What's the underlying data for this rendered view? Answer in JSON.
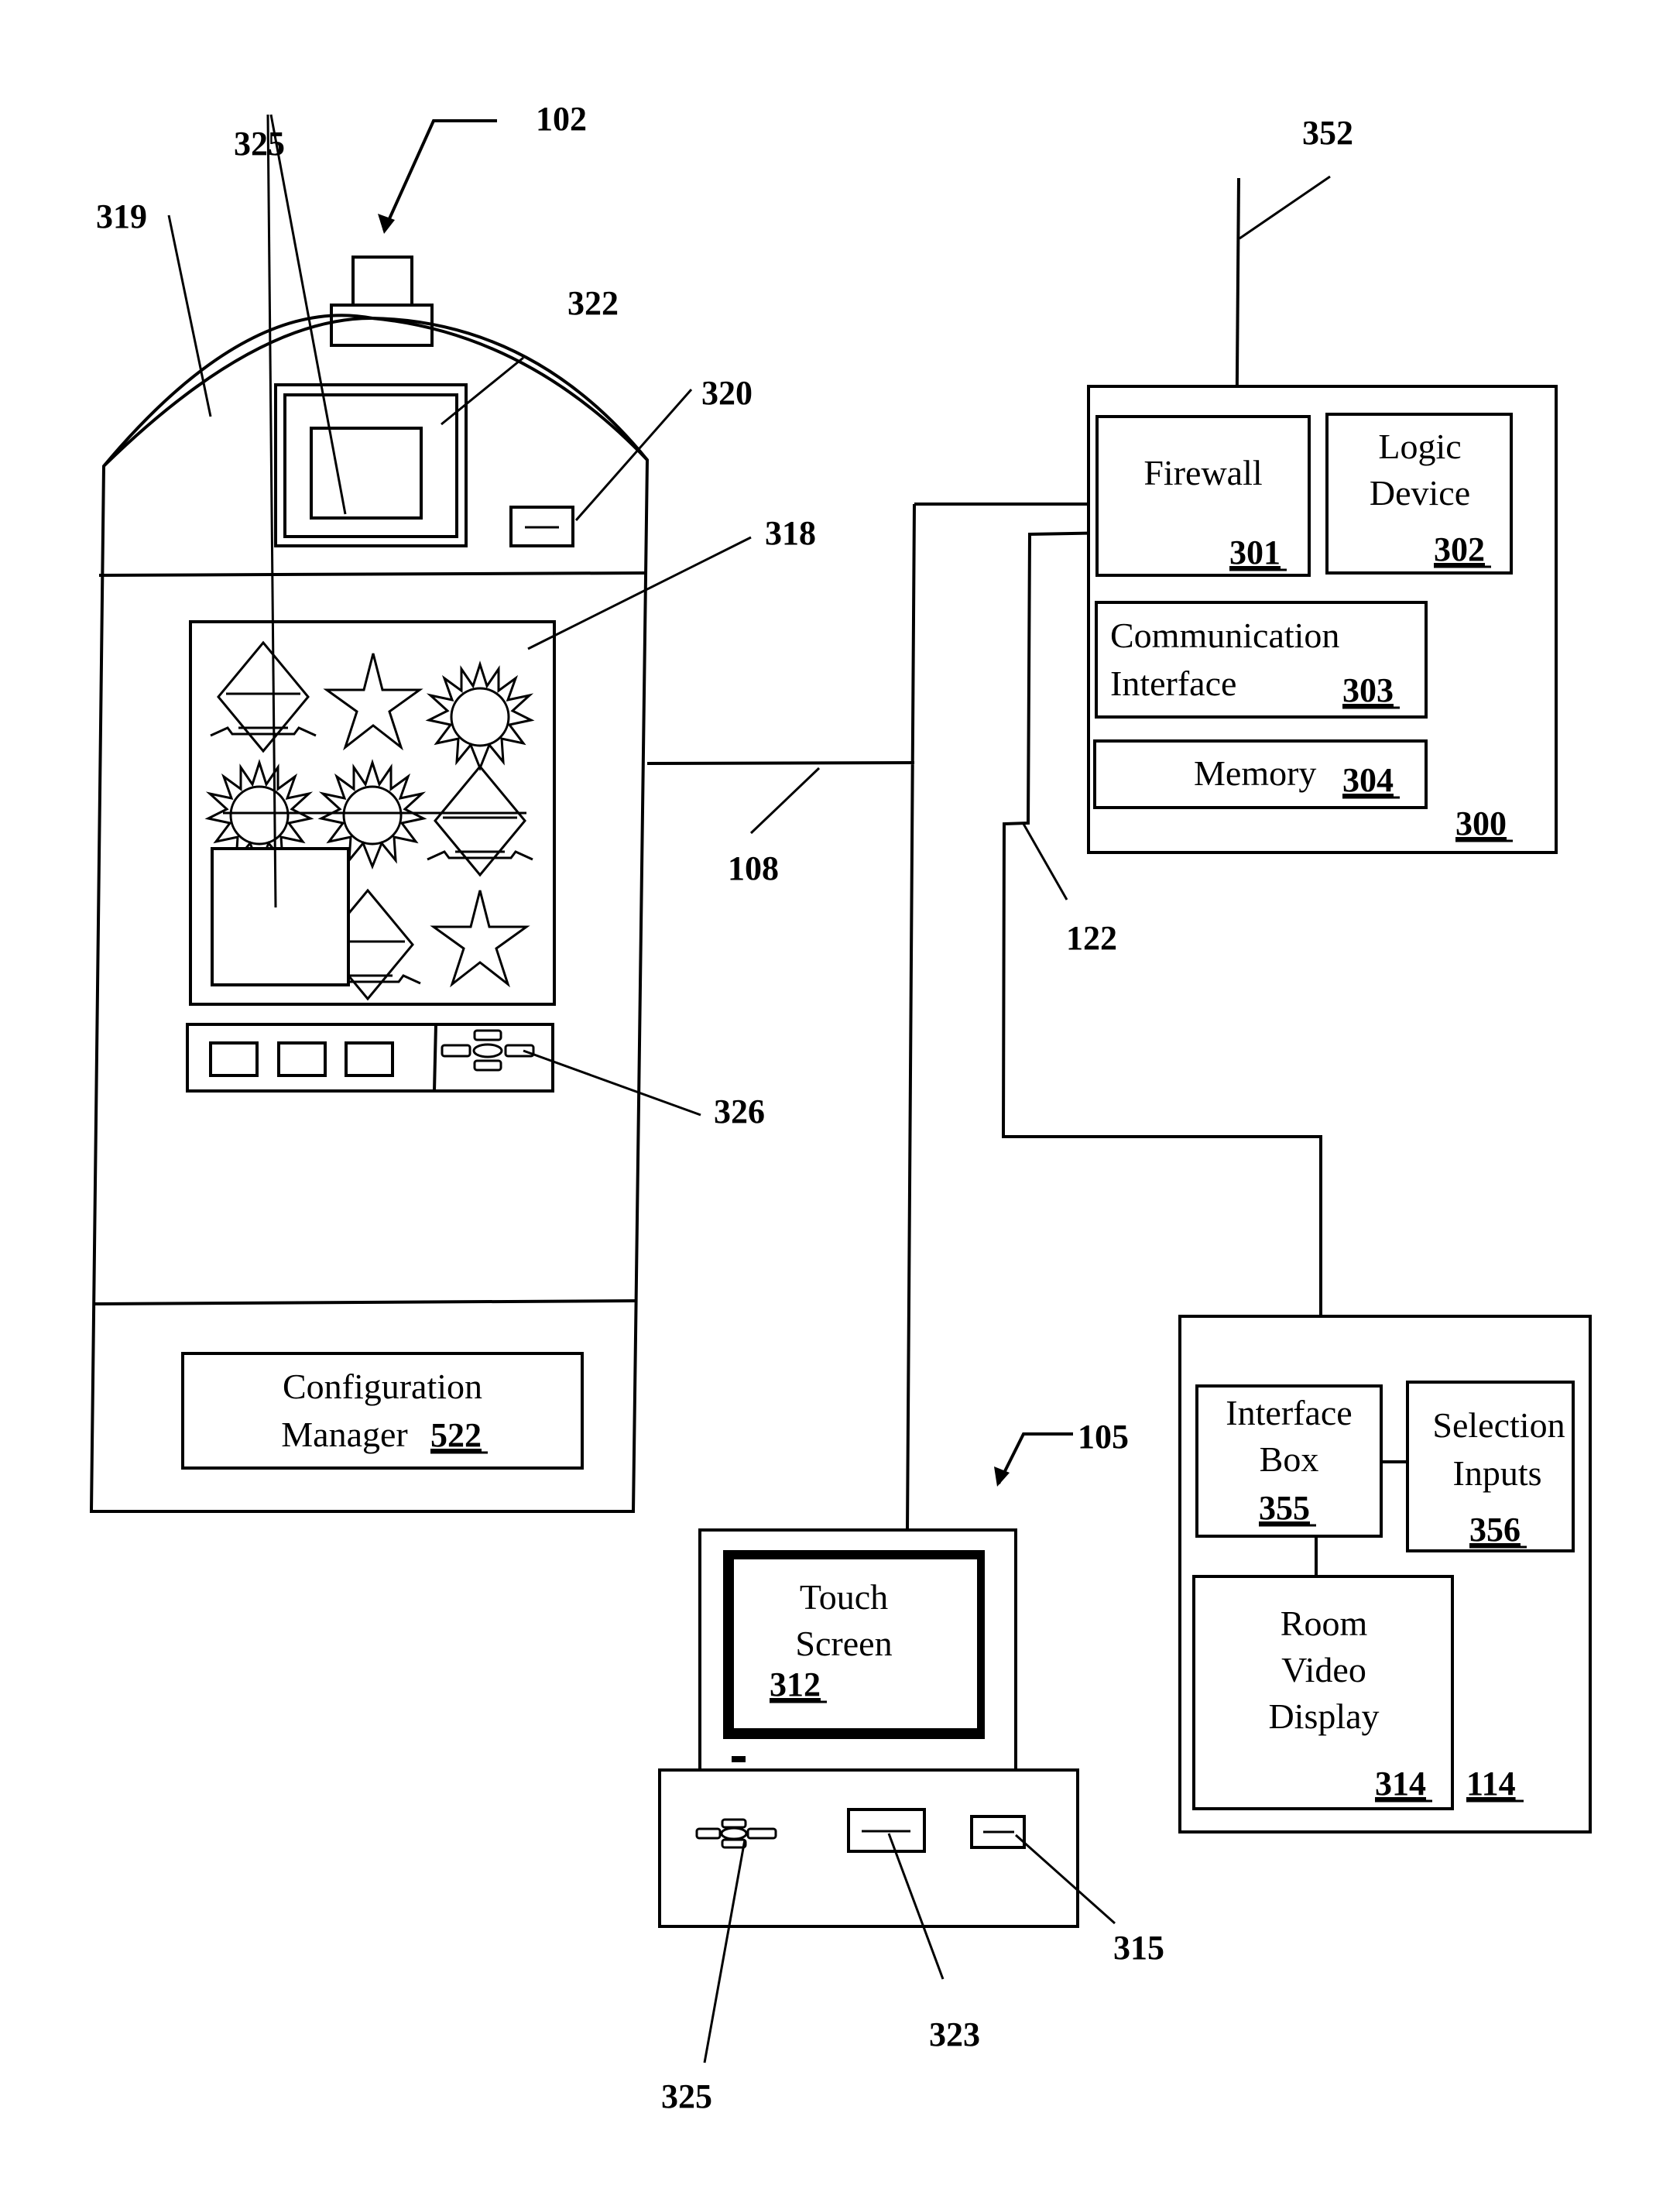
{
  "figure": {
    "gaming_machine": {
      "ref": "102",
      "labels": {
        "cabinet_top": "319",
        "player_tracking_reader": "325",
        "secondary_display": "322",
        "card_reader": "320",
        "primary_display": "318",
        "button_panel": "326"
      },
      "config_manager": {
        "line1": "Configuration",
        "line2": "Manager",
        "ref": "522"
      }
    },
    "network": {
      "link_108": "108",
      "link_122": "122",
      "link_352": "352"
    },
    "server": {
      "ref": "300",
      "firewall": {
        "label": "Firewall",
        "ref": "301"
      },
      "logic_device": {
        "line1": "Logic",
        "line2": "Device",
        "ref": "302"
      },
      "comm_interface": {
        "line1": "Communication",
        "line2": "Interface",
        "ref": "303"
      },
      "memory": {
        "label": "Memory",
        "ref": "304"
      }
    },
    "terminal": {
      "ref": "105",
      "touch_screen": {
        "line1": "Touch",
        "line2": "Screen",
        "ref": "312"
      },
      "keypad_ref": "325",
      "card_slot_ref": "323",
      "reader_ref": "315"
    },
    "room": {
      "ref": "114",
      "interface_box": {
        "line1": "Interface",
        "line2": "Box",
        "ref": "355"
      },
      "selection_inputs": {
        "line1": "Selection",
        "line2": "Inputs",
        "ref": "356"
      },
      "video_display": {
        "line1": "Room",
        "line2": "Video",
        "line3": "Display",
        "ref": "314"
      }
    }
  }
}
